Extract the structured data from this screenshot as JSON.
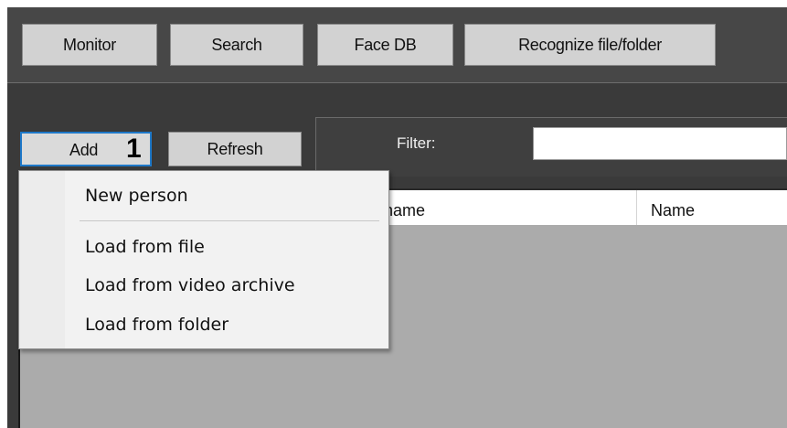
{
  "toolbar": {
    "buttons": [
      {
        "label": "Monitor"
      },
      {
        "label": "Search"
      },
      {
        "label": "Face DB"
      },
      {
        "label": "Recognize file/folder"
      }
    ]
  },
  "faces_panel": {
    "add_label": "Add",
    "add_badge": "1",
    "refresh_label": "Refresh",
    "filter_label": "Filter:",
    "filter_value": ""
  },
  "table": {
    "columns": [
      "name",
      "Name"
    ]
  },
  "add_menu": {
    "items": [
      {
        "label": "New person"
      },
      {
        "label": "Load from file"
      },
      {
        "label": "Load from video archive"
      },
      {
        "label": "Load from folder"
      }
    ]
  },
  "colors": {
    "dark_background": "#3a3a3a",
    "button_face": "#d2d2d2",
    "focus_border": "#1e78c8",
    "grid_background": "#ababab"
  }
}
